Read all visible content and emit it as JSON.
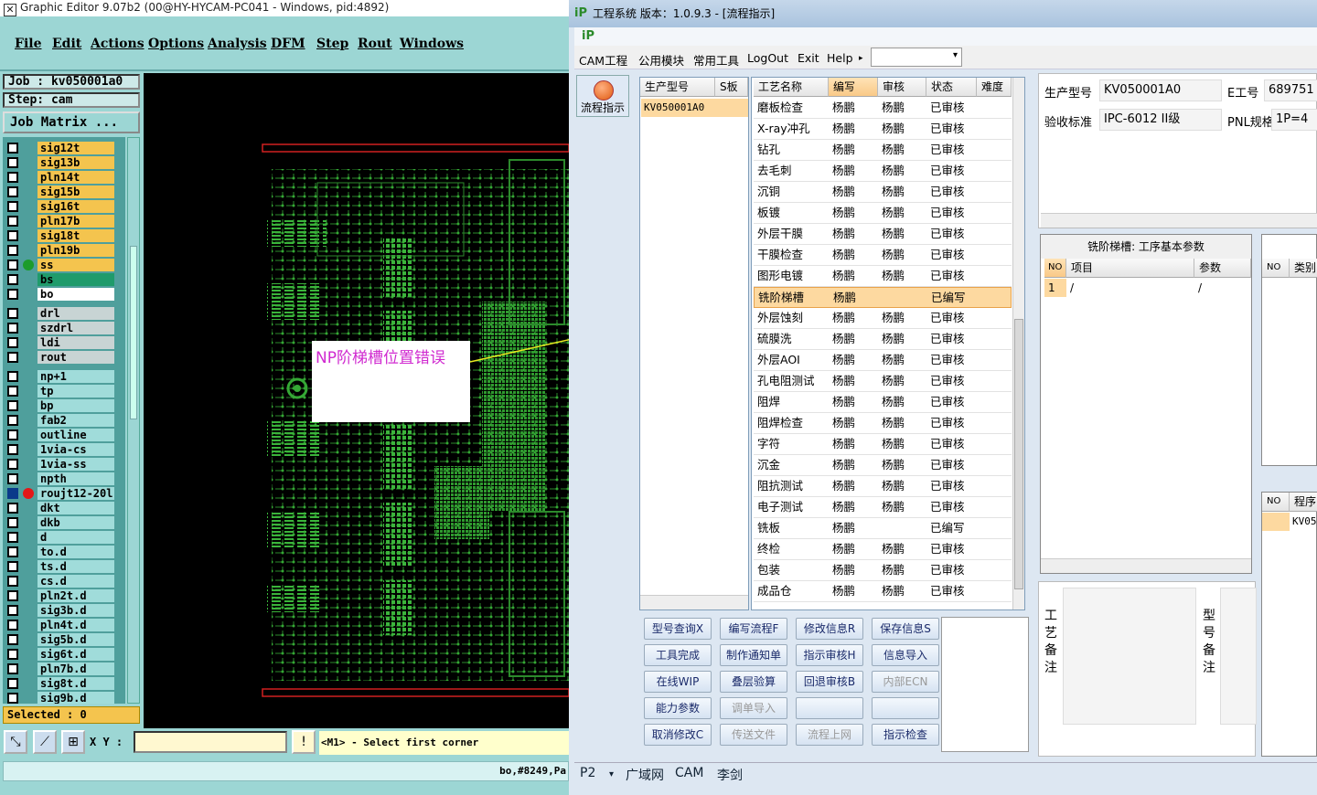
{
  "ge": {
    "title": "Graphic Editor 9.07b2 (00@HY-HYCAM-PC041 - Windows, pid:4892)",
    "menu": [
      "File",
      "Edit",
      "Actions",
      "Options",
      "Analysis",
      "DFM",
      "Step",
      "Rout",
      "Windows"
    ],
    "job": "Job : kv050001a0",
    "step": "Step: cam",
    "job_matrix": "Job Matrix ...",
    "layers": [
      {
        "name": "sig12t",
        "color": "#f4c44e"
      },
      {
        "name": "sig13b",
        "color": "#f4c44e"
      },
      {
        "name": "pln14t",
        "color": "#f4c44e"
      },
      {
        "name": "sig15b",
        "color": "#f4c44e"
      },
      {
        "name": "sig16t",
        "color": "#f4c44e"
      },
      {
        "name": "pln17b",
        "color": "#f4c44e"
      },
      {
        "name": "sig18t",
        "color": "#f4c44e"
      },
      {
        "name": "pln19b",
        "color": "#f4c44e"
      },
      {
        "name": "ss",
        "color": "#f4c44e",
        "dot": "#1c9c2c"
      },
      {
        "name": "bs",
        "color": "#1f9b6b"
      },
      {
        "name": "bo",
        "color": "#ffffff"
      },
      {
        "name": "drl",
        "color": "#c8d4d4",
        "gap": true
      },
      {
        "name": "szdrl",
        "color": "#c8d4d4"
      },
      {
        "name": "ldi",
        "color": "#c8d4d4"
      },
      {
        "name": "rout",
        "color": "#c8d4d4"
      },
      {
        "name": "np+1",
        "color": "#a0dcda",
        "gap": true
      },
      {
        "name": "tp",
        "color": "#a0dcda"
      },
      {
        "name": "bp",
        "color": "#a0dcda"
      },
      {
        "name": "fab2",
        "color": "#a0dcda"
      },
      {
        "name": "outline",
        "color": "#a0dcda"
      },
      {
        "name": "1via-cs",
        "color": "#a0dcda"
      },
      {
        "name": "1via-ss",
        "color": "#a0dcda"
      },
      {
        "name": "npth",
        "color": "#a0dcda"
      },
      {
        "name": "roujt12-20l",
        "color": "#a0dcda",
        "dot": "#e41818",
        "sel": true
      },
      {
        "name": "dkt",
        "color": "#a0dcda"
      },
      {
        "name": "dkb",
        "color": "#a0dcda"
      },
      {
        "name": "d",
        "color": "#a0dcda"
      },
      {
        "name": "to.d",
        "color": "#a0dcda"
      },
      {
        "name": "ts.d",
        "color": "#a0dcda"
      },
      {
        "name": "cs.d",
        "color": "#a0dcda"
      },
      {
        "name": "pln2t.d",
        "color": "#a0dcda"
      },
      {
        "name": "sig3b.d",
        "color": "#a0dcda"
      },
      {
        "name": "pln4t.d",
        "color": "#a0dcda"
      },
      {
        "name": "sig5b.d",
        "color": "#a0dcda"
      },
      {
        "name": "sig6t.d",
        "color": "#a0dcda"
      },
      {
        "name": "pln7b.d",
        "color": "#a0dcda"
      },
      {
        "name": "sig8t.d",
        "color": "#a0dcda"
      },
      {
        "name": "sig9b.d",
        "color": "#a0dcda"
      }
    ],
    "selected": "Selected : 0",
    "xy_label": "X Y :",
    "prompt": "<M1> - Select first corner",
    "status": "bo,#8249,Pa",
    "note": "NP阶梯槽位置错误"
  },
  "cam": {
    "title": "工程系统  版本：1.0.9.3 - [流程指示]",
    "menu": [
      "CAM工程",
      "公用模块",
      "常用工具",
      "LogOut",
      "Exit",
      "Help"
    ],
    "help_arrow": "▸",
    "flow_button": "流程指示",
    "model_headers": [
      "生产型号",
      "S板"
    ],
    "model_row": "KV050001A0",
    "process_headers": [
      "工艺名称",
      "编写",
      "审核",
      "状态",
      "难度"
    ],
    "process_rows": [
      {
        "name": "磨板检查",
        "writer": "杨鹏",
        "reviewer": "杨鹏",
        "status": "已审核"
      },
      {
        "name": "X-ray冲孔",
        "writer": "杨鹏",
        "reviewer": "杨鹏",
        "status": "已审核"
      },
      {
        "name": "钻孔",
        "writer": "杨鹏",
        "reviewer": "杨鹏",
        "status": "已审核"
      },
      {
        "name": "去毛刺",
        "writer": "杨鹏",
        "reviewer": "杨鹏",
        "status": "已审核"
      },
      {
        "name": "沉铜",
        "writer": "杨鹏",
        "reviewer": "杨鹏",
        "status": "已审核"
      },
      {
        "name": "板镀",
        "writer": "杨鹏",
        "reviewer": "杨鹏",
        "status": "已审核"
      },
      {
        "name": "外层干膜",
        "writer": "杨鹏",
        "reviewer": "杨鹏",
        "status": "已审核"
      },
      {
        "name": "干膜检查",
        "writer": "杨鹏",
        "reviewer": "杨鹏",
        "status": "已审核"
      },
      {
        "name": "图形电镀",
        "writer": "杨鹏",
        "reviewer": "杨鹏",
        "status": "已审核"
      },
      {
        "name": "铣阶梯槽",
        "writer": "杨鹏",
        "reviewer": "",
        "status": "已编写",
        "hl": true
      },
      {
        "name": "外层蚀刻",
        "writer": "杨鹏",
        "reviewer": "杨鹏",
        "status": "已审核"
      },
      {
        "name": "硫膜洗",
        "writer": "杨鹏",
        "reviewer": "杨鹏",
        "status": "已审核"
      },
      {
        "name": "外层AOI",
        "writer": "杨鹏",
        "reviewer": "杨鹏",
        "status": "已审核"
      },
      {
        "name": "孔电阻测试",
        "writer": "杨鹏",
        "reviewer": "杨鹏",
        "status": "已审核"
      },
      {
        "name": "阻焊",
        "writer": "杨鹏",
        "reviewer": "杨鹏",
        "status": "已审核"
      },
      {
        "name": "阻焊检查",
        "writer": "杨鹏",
        "reviewer": "杨鹏",
        "status": "已审核"
      },
      {
        "name": "字符",
        "writer": "杨鹏",
        "reviewer": "杨鹏",
        "status": "已审核"
      },
      {
        "name": "沉金",
        "writer": "杨鹏",
        "reviewer": "杨鹏",
        "status": "已审核"
      },
      {
        "name": "阻抗测试",
        "writer": "杨鹏",
        "reviewer": "杨鹏",
        "status": "已审核"
      },
      {
        "name": "电子测试",
        "writer": "杨鹏",
        "reviewer": "杨鹏",
        "status": "已审核"
      },
      {
        "name": "铣板",
        "writer": "杨鹏",
        "reviewer": "",
        "status": "已编写"
      },
      {
        "name": "终检",
        "writer": "杨鹏",
        "reviewer": "杨鹏",
        "status": "已审核"
      },
      {
        "name": "包装",
        "writer": "杨鹏",
        "reviewer": "杨鹏",
        "status": "已审核"
      },
      {
        "name": "成品仓",
        "writer": "杨鹏",
        "reviewer": "杨鹏",
        "status": "已审核"
      }
    ],
    "buttons": [
      [
        "型号查询X",
        "编写流程F",
        "修改信息R",
        "保存信息S"
      ],
      [
        "工具完成",
        "制作通知单",
        "指示审核H",
        "信息导入"
      ],
      [
        "在线WIP",
        "叠层验算",
        "回退审核B",
        "内部ECN"
      ],
      [
        "能力参数",
        "调单导入",
        "",
        ""
      ],
      [
        "取消修改C",
        "传送文件",
        "流程上网",
        "指示检查"
      ]
    ],
    "disabled_buttons": [
      "内部ECN",
      "调单导入",
      "传送文件",
      "流程上网"
    ],
    "info": {
      "model_label": "生产型号",
      "model_value": "KV050001A0",
      "eno_label": "E工号",
      "eno_value": "689751",
      "std_label": "验收标准",
      "std_value": "IPC-6012 II级",
      "pnl_label": "PNL规格",
      "pnl_value": "1P=4"
    },
    "param_title": "铣阶梯槽: 工序基本参数",
    "param_headers": [
      "NO",
      "项目",
      "参数"
    ],
    "param_row": [
      "1",
      "/",
      "/"
    ],
    "right_headers_a": [
      "NO",
      "类别"
    ],
    "right_headers_b": [
      "NO",
      "程序"
    ],
    "right_row_b": "KV05",
    "memo_label_a": "工艺备注",
    "memo_label_b": "型号备注",
    "status": [
      "P2",
      "▾",
      "广域网",
      "CAM",
      "李剑"
    ]
  }
}
